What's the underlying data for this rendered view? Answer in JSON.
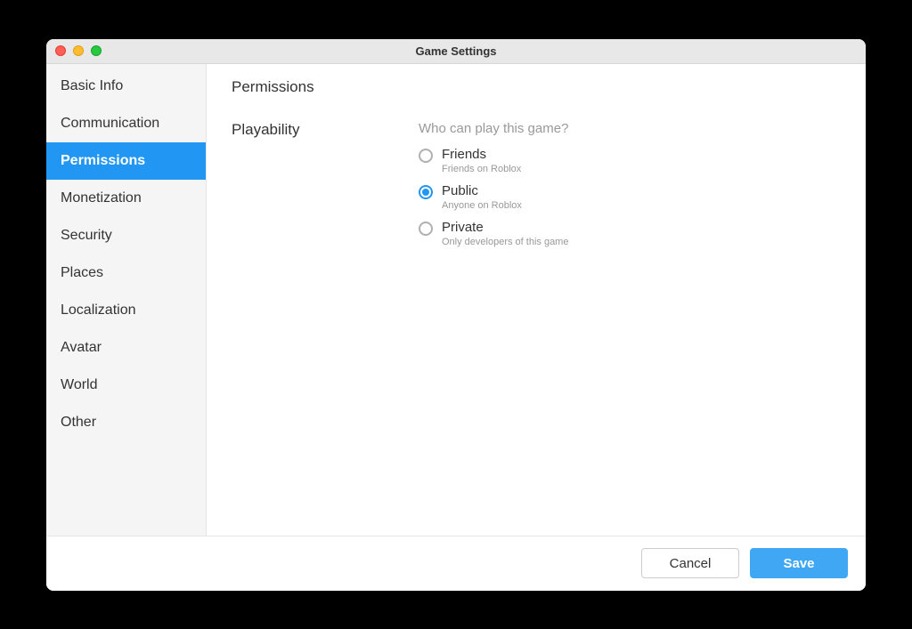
{
  "window": {
    "title": "Game Settings"
  },
  "sidebar": {
    "items": [
      {
        "label": "Basic Info",
        "active": false
      },
      {
        "label": "Communication",
        "active": false
      },
      {
        "label": "Permissions",
        "active": true
      },
      {
        "label": "Monetization",
        "active": false
      },
      {
        "label": "Security",
        "active": false
      },
      {
        "label": "Places",
        "active": false
      },
      {
        "label": "Localization",
        "active": false
      },
      {
        "label": "Avatar",
        "active": false
      },
      {
        "label": "World",
        "active": false
      },
      {
        "label": "Other",
        "active": false
      }
    ]
  },
  "main": {
    "section_title": "Permissions",
    "playability": {
      "label": "Playability",
      "question": "Who can play this game?",
      "options": [
        {
          "title": "Friends",
          "subtitle": "Friends on Roblox",
          "selected": false
        },
        {
          "title": "Public",
          "subtitle": "Anyone on Roblox",
          "selected": true
        },
        {
          "title": "Private",
          "subtitle": "Only developers of this game",
          "selected": false
        }
      ]
    }
  },
  "footer": {
    "cancel": "Cancel",
    "save": "Save"
  }
}
